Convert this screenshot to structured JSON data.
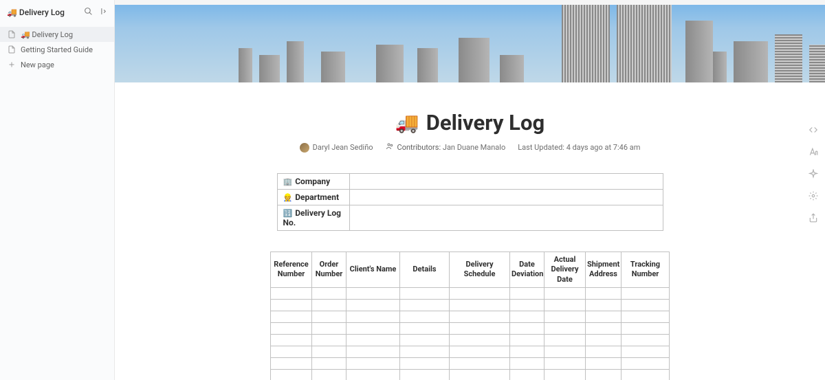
{
  "sidebar": {
    "title": "🚚 Delivery Log",
    "items": [
      {
        "icon": "📄",
        "label": "🚚 Delivery Log",
        "active": true
      },
      {
        "icon": "📄",
        "label": "Getting Started Guide",
        "active": false
      },
      {
        "icon": "+",
        "label": "New page",
        "active": false
      }
    ]
  },
  "page": {
    "emoji": "🚚",
    "title": "Delivery Log",
    "author": "Daryl Jean Sediño",
    "contributors_label": "Contributors:",
    "contributors": "Jan Duane Manalo",
    "last_updated_label": "Last Updated:",
    "last_updated": "4 days ago at 7:46 am"
  },
  "info_table": [
    {
      "icon": "🏢",
      "label": "Company",
      "value": ""
    },
    {
      "icon": "👷",
      "label": "Department",
      "value": ""
    },
    {
      "icon": "🔢",
      "label": "Delivery Log No.",
      "value": ""
    }
  ],
  "data_table": {
    "columns": [
      "Reference Number",
      "Order Number",
      "Client's Name",
      "Details",
      "Delivery Schedule",
      "Date Deviation",
      "Actual Delivery Date",
      "Shipment Address",
      "Tracking Number"
    ],
    "rows": 8
  }
}
